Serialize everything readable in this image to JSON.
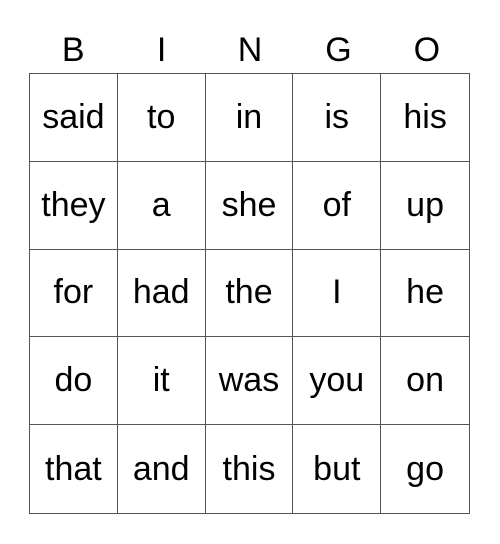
{
  "header": [
    "B",
    "I",
    "N",
    "G",
    "O"
  ],
  "rows": [
    [
      "said",
      "to",
      "in",
      "is",
      "his"
    ],
    [
      "they",
      "a",
      "she",
      "of",
      "up"
    ],
    [
      "for",
      "had",
      "the",
      "I",
      "he"
    ],
    [
      "do",
      "it",
      "was",
      "you",
      "on"
    ],
    [
      "that",
      "and",
      "this",
      "but",
      "go"
    ]
  ]
}
